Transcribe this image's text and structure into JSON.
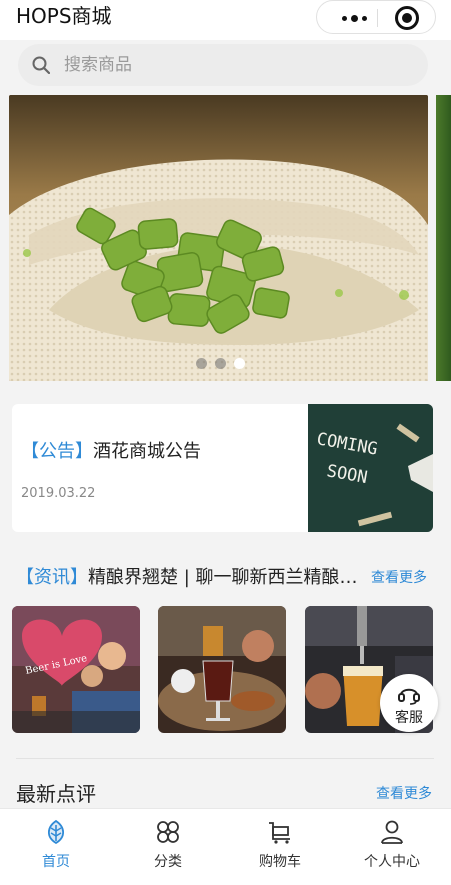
{
  "header": {
    "title": "HOPS商城"
  },
  "search": {
    "placeholder": "搜索商品"
  },
  "banner": {
    "slide_count": 3,
    "active_slide": 3
  },
  "notice": {
    "tag": "【公告】",
    "title": "酒花商城公告",
    "date": "2019.03.22",
    "image_text": [
      "COMING",
      "SOON"
    ]
  },
  "news": {
    "tag": "【资讯】",
    "title": "精酿界翘楚 | 聊一聊新西兰精酿…",
    "more": "查看更多"
  },
  "thumb_text": "Beer is Love",
  "customer_service": {
    "label": "客服"
  },
  "reviews": {
    "title": "最新点评",
    "more": "查看更多"
  },
  "tabs": [
    {
      "label": "首页",
      "icon": "leaf-icon",
      "active": true
    },
    {
      "label": "分类",
      "icon": "grid-icon",
      "active": false
    },
    {
      "label": "购物车",
      "icon": "cart-icon",
      "active": false
    },
    {
      "label": "个人中心",
      "icon": "user-icon",
      "active": false
    }
  ],
  "colors": {
    "accent": "#2f8ad6",
    "page_bg": "#f3f3f3"
  }
}
